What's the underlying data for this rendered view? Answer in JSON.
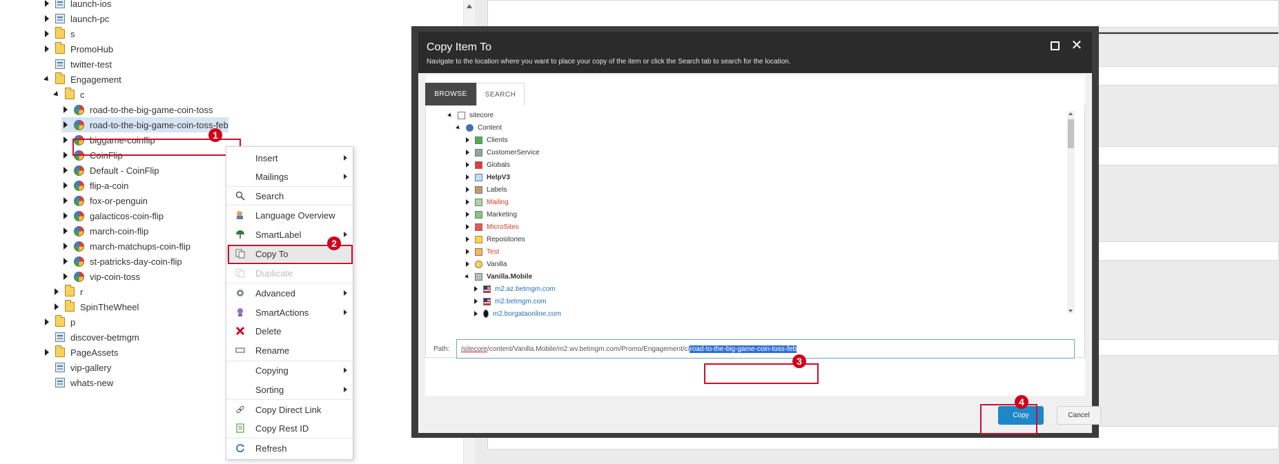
{
  "tree": {
    "items": [
      {
        "label": "launch-ios",
        "icon": "page-icon"
      },
      {
        "label": "launch-pc",
        "icon": "page-icon"
      },
      {
        "label": "s",
        "icon": "folder-icon"
      },
      {
        "label": "PromoHub",
        "icon": "folder-icon"
      },
      {
        "label": "twitter-test",
        "icon": "page-icon"
      },
      {
        "label": "Engagement",
        "icon": "folder-icon"
      },
      {
        "label": "c",
        "icon": "folder-icon"
      },
      {
        "label": "road-to-the-big-game-coin-toss",
        "icon": "coin-icon"
      },
      {
        "label": "road-to-the-big-game-coin-toss-feb",
        "icon": "coin-icon"
      },
      {
        "label": "biggame-coinflip",
        "icon": "coin-icon"
      },
      {
        "label": "CoinFlip",
        "icon": "coin-icon"
      },
      {
        "label": "Default - CoinFlip",
        "icon": "coin-icon"
      },
      {
        "label": "flip-a-coin",
        "icon": "coin-icon"
      },
      {
        "label": "fox-or-penguin",
        "icon": "coin-icon"
      },
      {
        "label": "galacticos-coin-flip",
        "icon": "coin-icon"
      },
      {
        "label": "march-coin-flip",
        "icon": "coin-icon"
      },
      {
        "label": "march-matchups-coin-flip",
        "icon": "coin-icon"
      },
      {
        "label": "st-patricks-day-coin-flip",
        "icon": "coin-icon"
      },
      {
        "label": "vip-coin-toss",
        "icon": "coin-icon"
      },
      {
        "label": "r",
        "icon": "folder-icon"
      },
      {
        "label": "SpinTheWheel",
        "icon": "folder-icon"
      },
      {
        "label": "p",
        "icon": "folder-icon"
      },
      {
        "label": "discover-betmgm",
        "icon": "page-icon"
      },
      {
        "label": "PageAssets",
        "icon": "folder-icon"
      },
      {
        "label": "vip-gallery",
        "icon": "page-icon"
      },
      {
        "label": "whats-new",
        "icon": "page-icon"
      }
    ]
  },
  "context_menu": {
    "items": [
      {
        "label": "Insert",
        "submenu": true
      },
      {
        "label": "Mailings",
        "submenu": true
      },
      {
        "label": "Search",
        "icon": "search-icon"
      },
      {
        "label": "Language Overview",
        "icon": "language-icon"
      },
      {
        "label": "SmartLabel",
        "icon": "umbrella-icon",
        "submenu": true
      },
      {
        "label": "Copy To",
        "icon": "copy-to-icon"
      },
      {
        "label": "Duplicate",
        "icon": "duplicate-icon",
        "disabled": true
      },
      {
        "label": "Advanced",
        "icon": "gear-icon",
        "submenu": true
      },
      {
        "label": "SmartActions",
        "icon": "smartactions-icon",
        "submenu": true
      },
      {
        "label": "Delete",
        "icon": "delete-icon"
      },
      {
        "label": "Rename",
        "icon": "rename-icon"
      },
      {
        "label": "Copying",
        "submenu": true
      },
      {
        "label": "Sorting",
        "submenu": true
      },
      {
        "label": "Copy Direct Link",
        "icon": "link-icon"
      },
      {
        "label": "Copy Rest ID",
        "icon": "rest-id-icon"
      },
      {
        "label": "Refresh",
        "icon": "refresh-icon"
      }
    ]
  },
  "badges": {
    "b1": "1",
    "b2": "2",
    "b3": "3",
    "b4": "4"
  },
  "dialog": {
    "title": "Copy Item To",
    "subtitle": "Navigate to the location where you want to place your copy of the item or click the Search tab to search for the location.",
    "tabs": {
      "browse": "BROWSE",
      "search": "SEARCH"
    },
    "tree": [
      {
        "label": "sitecore"
      },
      {
        "label": "Content"
      },
      {
        "label": "Clients"
      },
      {
        "label": "CustomerService"
      },
      {
        "label": "Globals"
      },
      {
        "label": "HelpV3"
      },
      {
        "label": "Labels"
      },
      {
        "label": "Mailing"
      },
      {
        "label": "Marketing"
      },
      {
        "label": "MicroSites"
      },
      {
        "label": "Repositories"
      },
      {
        "label": "Test"
      },
      {
        "label": "Vanilla"
      },
      {
        "label": "Vanilla.Mobile"
      },
      {
        "label": "m2.az.betmgm.com"
      },
      {
        "label": "m2.betmgm.com"
      },
      {
        "label": "m2.borgataonline.com"
      }
    ],
    "path_label": "Path:",
    "path_prefix_link": "/sitecore",
    "path_middle": "/content/Vanilla.Mobile/m2.wv.betmgm.com/Promo/Engagement/c/",
    "path_selected": "road-to-the-big-game-coin-toss-feb",
    "copy_label": "Copy",
    "cancel_label": "Cancel"
  }
}
